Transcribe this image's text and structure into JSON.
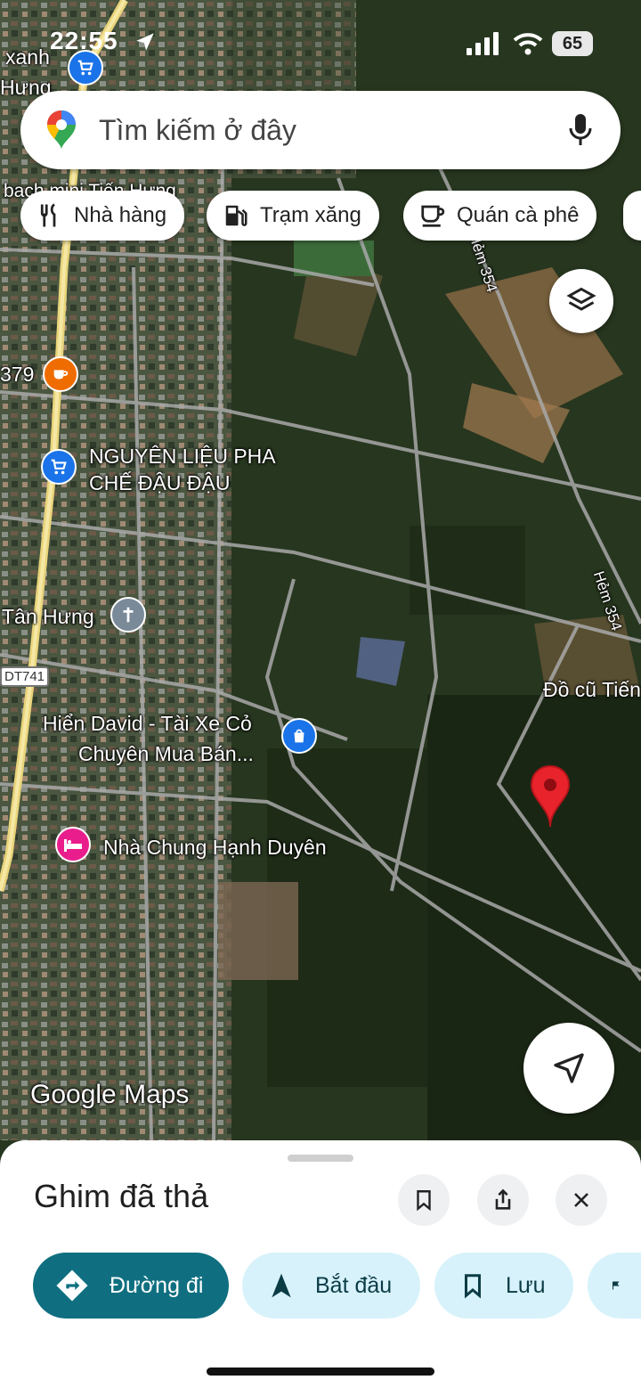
{
  "status_bar": {
    "time": "22:55",
    "battery": "65"
  },
  "search": {
    "placeholder": "Tìm kiếm ở đây"
  },
  "chips": [
    {
      "label": "Nhà hàng",
      "icon": "restaurant-icon"
    },
    {
      "label": "Trạm xăng",
      "icon": "gas-station-icon"
    },
    {
      "label": "Quán cà phê",
      "icon": "coffee-icon"
    }
  ],
  "map": {
    "labels": {
      "xanh": "xanh",
      "hung": "Hưng",
      "bach_hoa": "bach mini Tiến Hưng",
      "num379": "379",
      "nguyen_lieu_1": "NGUYÊN LIỆU PHA",
      "nguyen_lieu_2": "CHẾ ĐẬU ĐẬU",
      "tan_hung": "Tân Hưng",
      "route_badge": "DT741",
      "hien_david_1": "Hiển David - Tài Xe Cỏ",
      "hien_david_2": "Chuyên Mua Bán...",
      "nha_chung": "Nhà Chung Hạnh Duyên",
      "do_cu": "Đồ cũ Tiến",
      "hem354_a": "Hẻm 354",
      "hem354_b": "Hẻm 354",
      "watermark": "Google Maps"
    }
  },
  "sheet": {
    "title": "Ghim đã thả",
    "actions": {
      "directions": "Đường đi",
      "start": "Bắt đầu",
      "save": "Lưu"
    }
  },
  "colors": {
    "accent": "#0f6f80",
    "pin": "#e8232b",
    "chip_light": "#d7f2fb"
  }
}
